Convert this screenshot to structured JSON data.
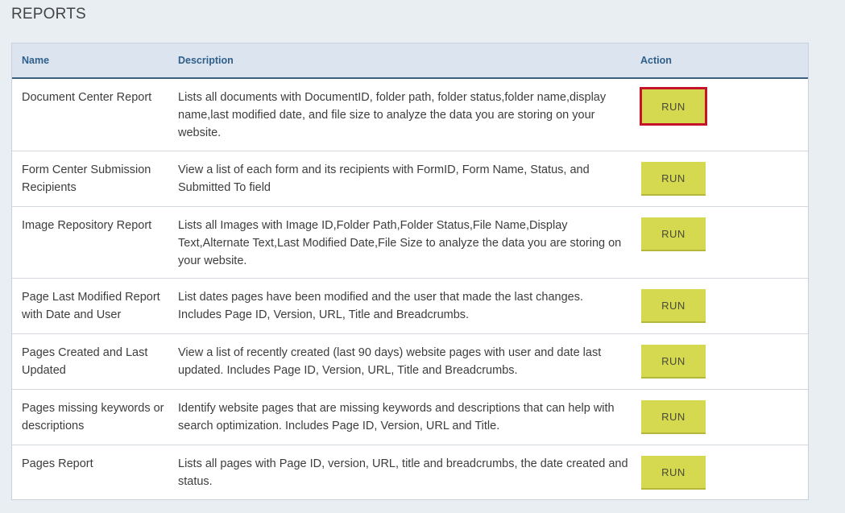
{
  "page": {
    "title": "REPORTS"
  },
  "table": {
    "headers": {
      "name": "Name",
      "description": "Description",
      "action": "Action"
    },
    "rows": [
      {
        "name": "Document Center Report",
        "description": "Lists all documents with DocumentID, folder path, folder status,folder name,display name,last modified date, and file size to analyze the data you are storing on your website.",
        "action": "RUN"
      },
      {
        "name": "Form Center Submission Recipients",
        "description": "View a list of each form and its recipients with FormID, Form Name, Status, and Submitted To field",
        "action": "RUN"
      },
      {
        "name": "Image Repository Report",
        "description": "Lists all Images with Image ID,Folder Path,Folder Status,File Name,Display Text,Alternate Text,Last Modified Date,File Size to analyze the data you are storing on your website.",
        "action": "RUN"
      },
      {
        "name": "Page Last Modified Report with Date and User",
        "description": "List dates pages have been modified and the user that made the last changes. Includes Page ID, Version, URL, Title and Breadcrumbs.",
        "action": "RUN"
      },
      {
        "name": "Pages Created and Last Updated",
        "description": "View a list of recently created (last 90 days) website pages with user and date last updated. Includes Page ID, Version, URL, Title and Breadcrumbs.",
        "action": "RUN"
      },
      {
        "name": "Pages missing keywords or descriptions",
        "description": "Identify website pages that are missing keywords and descriptions that can help with search optimization. Includes Page ID, Version, URL and Title.",
        "action": "RUN"
      },
      {
        "name": "Pages Report",
        "description": "Lists all pages with Page ID, version, URL, title and breadcrumbs, the date created and status.",
        "action": "RUN"
      }
    ]
  },
  "colors": {
    "run_button": "#d4d94f",
    "focus_outline": "#c4142a",
    "header_text": "#2f5f8a",
    "header_bg": "#dbe4ef"
  }
}
